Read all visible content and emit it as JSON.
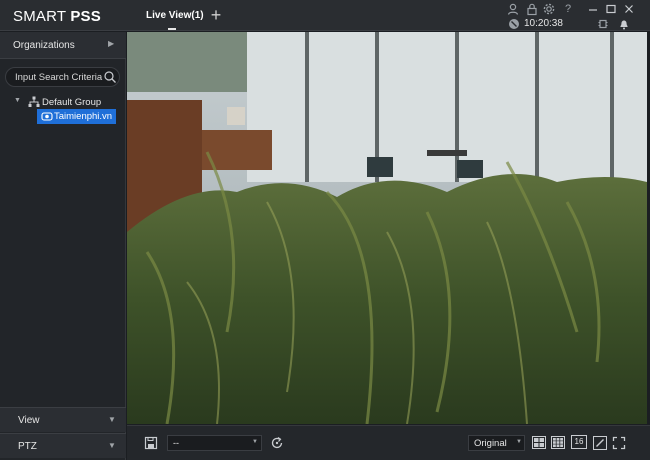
{
  "app": {
    "logo_prefix": "SMART",
    "logo_bold": "PSS"
  },
  "tabs": [
    {
      "label": "Live View(1)"
    }
  ],
  "header": {
    "add_tab_label": "+",
    "time": "10:20:38",
    "icons": [
      "user-icon",
      "lock-icon",
      "settings-gear-icon",
      "help-icon",
      "minimize-icon",
      "maximize-icon",
      "close-icon",
      "status-icon",
      "device-icon",
      "alarm-bell-icon"
    ]
  },
  "sidebar": {
    "organizations_label": "Organizations",
    "search_placeholder": "Input Search Criteria",
    "tree": {
      "group_label": "Default Group",
      "device_label": "Taimienphi.vn"
    },
    "view_label": "View",
    "ptz_label": "PTZ"
  },
  "toolbar": {
    "stream_value": "--",
    "ratio_value": "Original",
    "layout_16_label": "16",
    "icons": [
      "save-icon",
      "refresh-icon",
      "layout-4-icon",
      "layout-9-icon",
      "layout-16-icon",
      "edit-layout-icon",
      "fullscreen-icon"
    ]
  },
  "colors": {
    "accent": "#1f6fd8",
    "background": "#1b1e22",
    "panel": "#2b2e33"
  }
}
